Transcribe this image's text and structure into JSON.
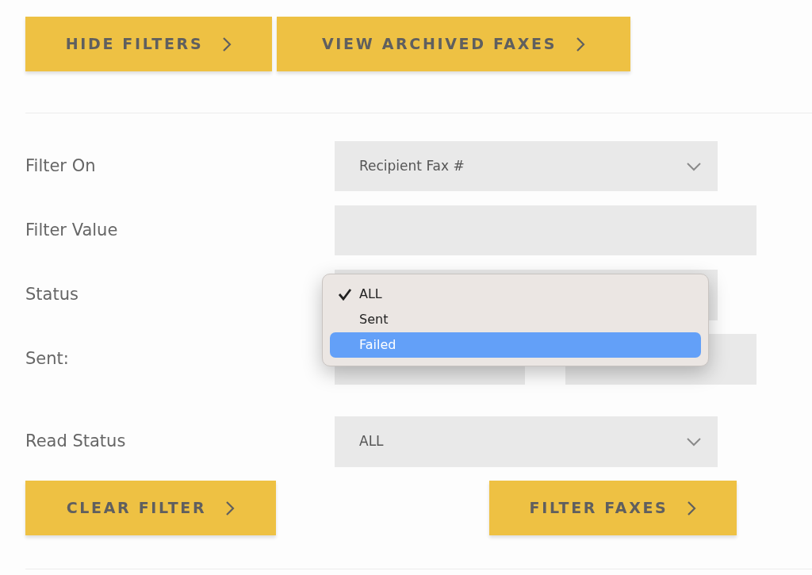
{
  "top_buttons": [
    "HIDE FILTERS",
    "VIEW ARCHIVED FAXES"
  ],
  "filter_on": {
    "label": "Filter On",
    "value": "Recipient Fax #"
  },
  "filter_value": {
    "label": "Filter Value"
  },
  "status": {
    "label": "Status",
    "menu": [
      {
        "label": "ALL",
        "selected": true,
        "highlighted": false
      },
      {
        "label": "Sent",
        "selected": false,
        "highlighted": false
      },
      {
        "label": "Failed",
        "selected": false,
        "highlighted": true
      }
    ]
  },
  "sent": {
    "label": "Sent:"
  },
  "read_status": {
    "label": "Read Status",
    "value": "ALL"
  },
  "bottom_buttons": [
    "CLEAR FILTER",
    "FILTER FAXES"
  ]
}
